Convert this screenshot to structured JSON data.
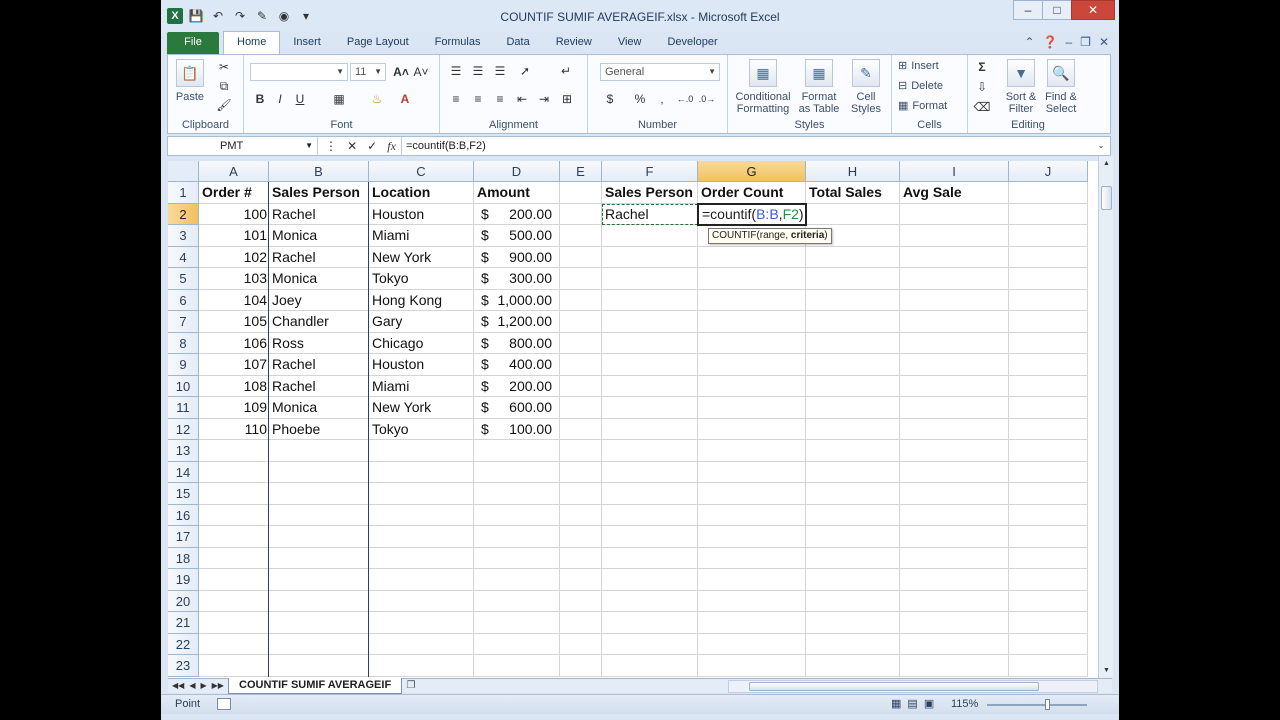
{
  "window": {
    "title": "COUNTIF SUMIF AVERAGEIF.xlsx  -  Microsoft Excel",
    "app_icon": "X"
  },
  "tabs": [
    "File",
    "Home",
    "Insert",
    "Page Layout",
    "Formulas",
    "Data",
    "Review",
    "View",
    "Developer"
  ],
  "active_tab": "Home",
  "ribbon": {
    "clipboard": {
      "label": "Clipboard",
      "paste": "Paste"
    },
    "font": {
      "label": "Font",
      "size": "11",
      "bold": "B",
      "italic": "I",
      "underline": "U"
    },
    "alignment": {
      "label": "Alignment"
    },
    "number": {
      "label": "Number",
      "format": "General",
      "currency": "$",
      "percent": "%"
    },
    "styles": {
      "label": "Styles",
      "conditional": [
        "Conditional",
        "Formatting"
      ],
      "format_table": [
        "Format",
        "as Table"
      ],
      "cell_styles": [
        "Cell",
        "Styles"
      ]
    },
    "cells": {
      "label": "Cells",
      "insert": "Insert",
      "delete": "Delete",
      "format": "Format"
    },
    "editing": {
      "label": "Editing",
      "sort": [
        "Sort &",
        "Filter"
      ],
      "find": [
        "Find &",
        "Select"
      ]
    }
  },
  "formula_bar": {
    "name_box": "PMT",
    "fx": "fx",
    "formula": "=countif(B:B,F2)"
  },
  "columns": [
    {
      "id": "A",
      "w": 70
    },
    {
      "id": "B",
      "w": 100
    },
    {
      "id": "C",
      "w": 105
    },
    {
      "id": "D",
      "w": 86
    },
    {
      "id": "E",
      "w": 42
    },
    {
      "id": "F",
      "w": 96
    },
    {
      "id": "G",
      "w": 108
    },
    {
      "id": "H",
      "w": 94
    },
    {
      "id": "I",
      "w": 109
    },
    {
      "id": "J",
      "w": 79
    }
  ],
  "selected_column": "G",
  "selected_row": "2",
  "rows": [
    "1",
    "2",
    "3",
    "4",
    "5",
    "6",
    "7",
    "8",
    "9",
    "10",
    "11",
    "12",
    "13",
    "14",
    "15",
    "16",
    "17",
    "18",
    "19",
    "20",
    "21",
    "22",
    "23"
  ],
  "headers": {
    "A1": "Order #",
    "B1": "Sales Person",
    "C1": "Location",
    "D1": "Amount",
    "F1": "Sales Person",
    "G1": "Order Count",
    "H1": "Total Sales",
    "I1": "Avg Sale"
  },
  "table": [
    {
      "order": "100",
      "person": "Rachel",
      "location": "Houston",
      "amount": "200.00"
    },
    {
      "order": "101",
      "person": "Monica",
      "location": "Miami",
      "amount": "500.00"
    },
    {
      "order": "102",
      "person": "Rachel",
      "location": "New York",
      "amount": "900.00"
    },
    {
      "order": "103",
      "person": "Monica",
      "location": "Tokyo",
      "amount": "300.00"
    },
    {
      "order": "104",
      "person": "Joey",
      "location": "Hong Kong",
      "amount": "1,000.00"
    },
    {
      "order": "105",
      "person": "Chandler",
      "location": "Gary",
      "amount": "1,200.00"
    },
    {
      "order": "106",
      "person": "Ross",
      "location": "Chicago",
      "amount": "800.00"
    },
    {
      "order": "107",
      "person": "Rachel",
      "location": "Houston",
      "amount": "400.00"
    },
    {
      "order": "108",
      "person": "Rachel",
      "location": "Miami",
      "amount": "200.00"
    },
    {
      "order": "109",
      "person": "Monica",
      "location": "New York",
      "amount": "600.00"
    },
    {
      "order": "110",
      "person": "Phoebe",
      "location": "Tokyo",
      "amount": "100.00"
    }
  ],
  "currency_symbol": "$",
  "F2": "Rachel",
  "G2_edit": {
    "prefix": "=countif(",
    "ref1": "B:B",
    "comma": ",",
    "ref2": "F2",
    "suffix": ")"
  },
  "tooltip": {
    "fn": "COUNTIF(range, ",
    "arg": "criteria",
    "close": ")"
  },
  "sheet_tab": "COUNTIF SUMIF AVERAGEIF",
  "status": {
    "mode": "Point",
    "zoom": "115%"
  },
  "colors": {
    "ref1": "#3a5fcd",
    "ref2": "#2f8a3e",
    "accent": "#f1c15f"
  }
}
